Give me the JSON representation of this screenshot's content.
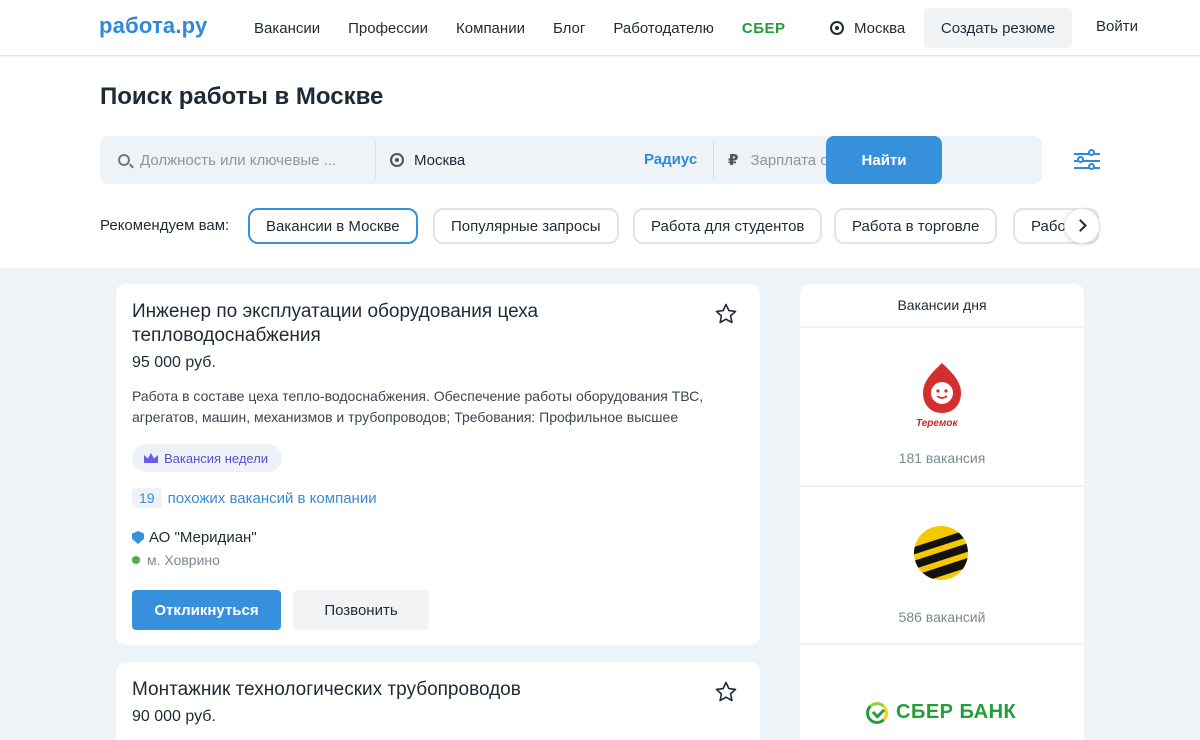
{
  "header": {
    "logo": "работа.ру",
    "nav": [
      "Вакансии",
      "Профессии",
      "Компании",
      "Блог",
      "Работодателю",
      "СБЕР"
    ],
    "city": "Москва",
    "create_resume": "Создать резюме",
    "login": "Войти"
  },
  "search": {
    "title": "Поиск работы в Москве",
    "query_placeholder": "Должность или ключевые ...",
    "location_value": "Москва",
    "radius_label": "Радиус",
    "salary_placeholder": "Зарплата от, руб.",
    "currency_symbol": "₽",
    "find_label": "Найти"
  },
  "recommend": {
    "label": "Рекомендуем вам:",
    "chips": [
      "Вакансии в Москве",
      "Популярные запросы",
      "Работа для студентов",
      "Работа в торговле",
      "Работа"
    ]
  },
  "jobs": [
    {
      "title": "Инженер по эксплуатации оборудования цеха тепловодоснабжения",
      "salary": "95 000 руб.",
      "description_line1": "Работа в составе цеха тепло-водоснабжения. Обеспечение работы оборудования ТВС,",
      "description_line2": "агрегатов, машин, механизмов и трубопроводов; Требования: Профильное высшее",
      "badge": "Вакансия недели",
      "similar_count": "19",
      "similar_text": "похожих вакансий в компании",
      "company": "АО \"Меридиан\"",
      "metro": "м. Ховрино",
      "apply_label": "Откликнуться",
      "call_label": "Позвонить"
    },
    {
      "title": "Монтажник технологических трубопроводов",
      "salary": "90 000 руб."
    }
  ],
  "sidebar": {
    "title": "Вакансии дня",
    "items": [
      {
        "logo_text": "Теремок",
        "count": "181 вакансия"
      },
      {
        "count": "586 вакансий"
      },
      {
        "logo_text": "СБЕР БАНК"
      }
    ]
  },
  "colors": {
    "accent": "#3790dc",
    "sber_green": "#21a038",
    "badge_purple": "#6c5ce7",
    "page_bg": "#eef3f8"
  }
}
